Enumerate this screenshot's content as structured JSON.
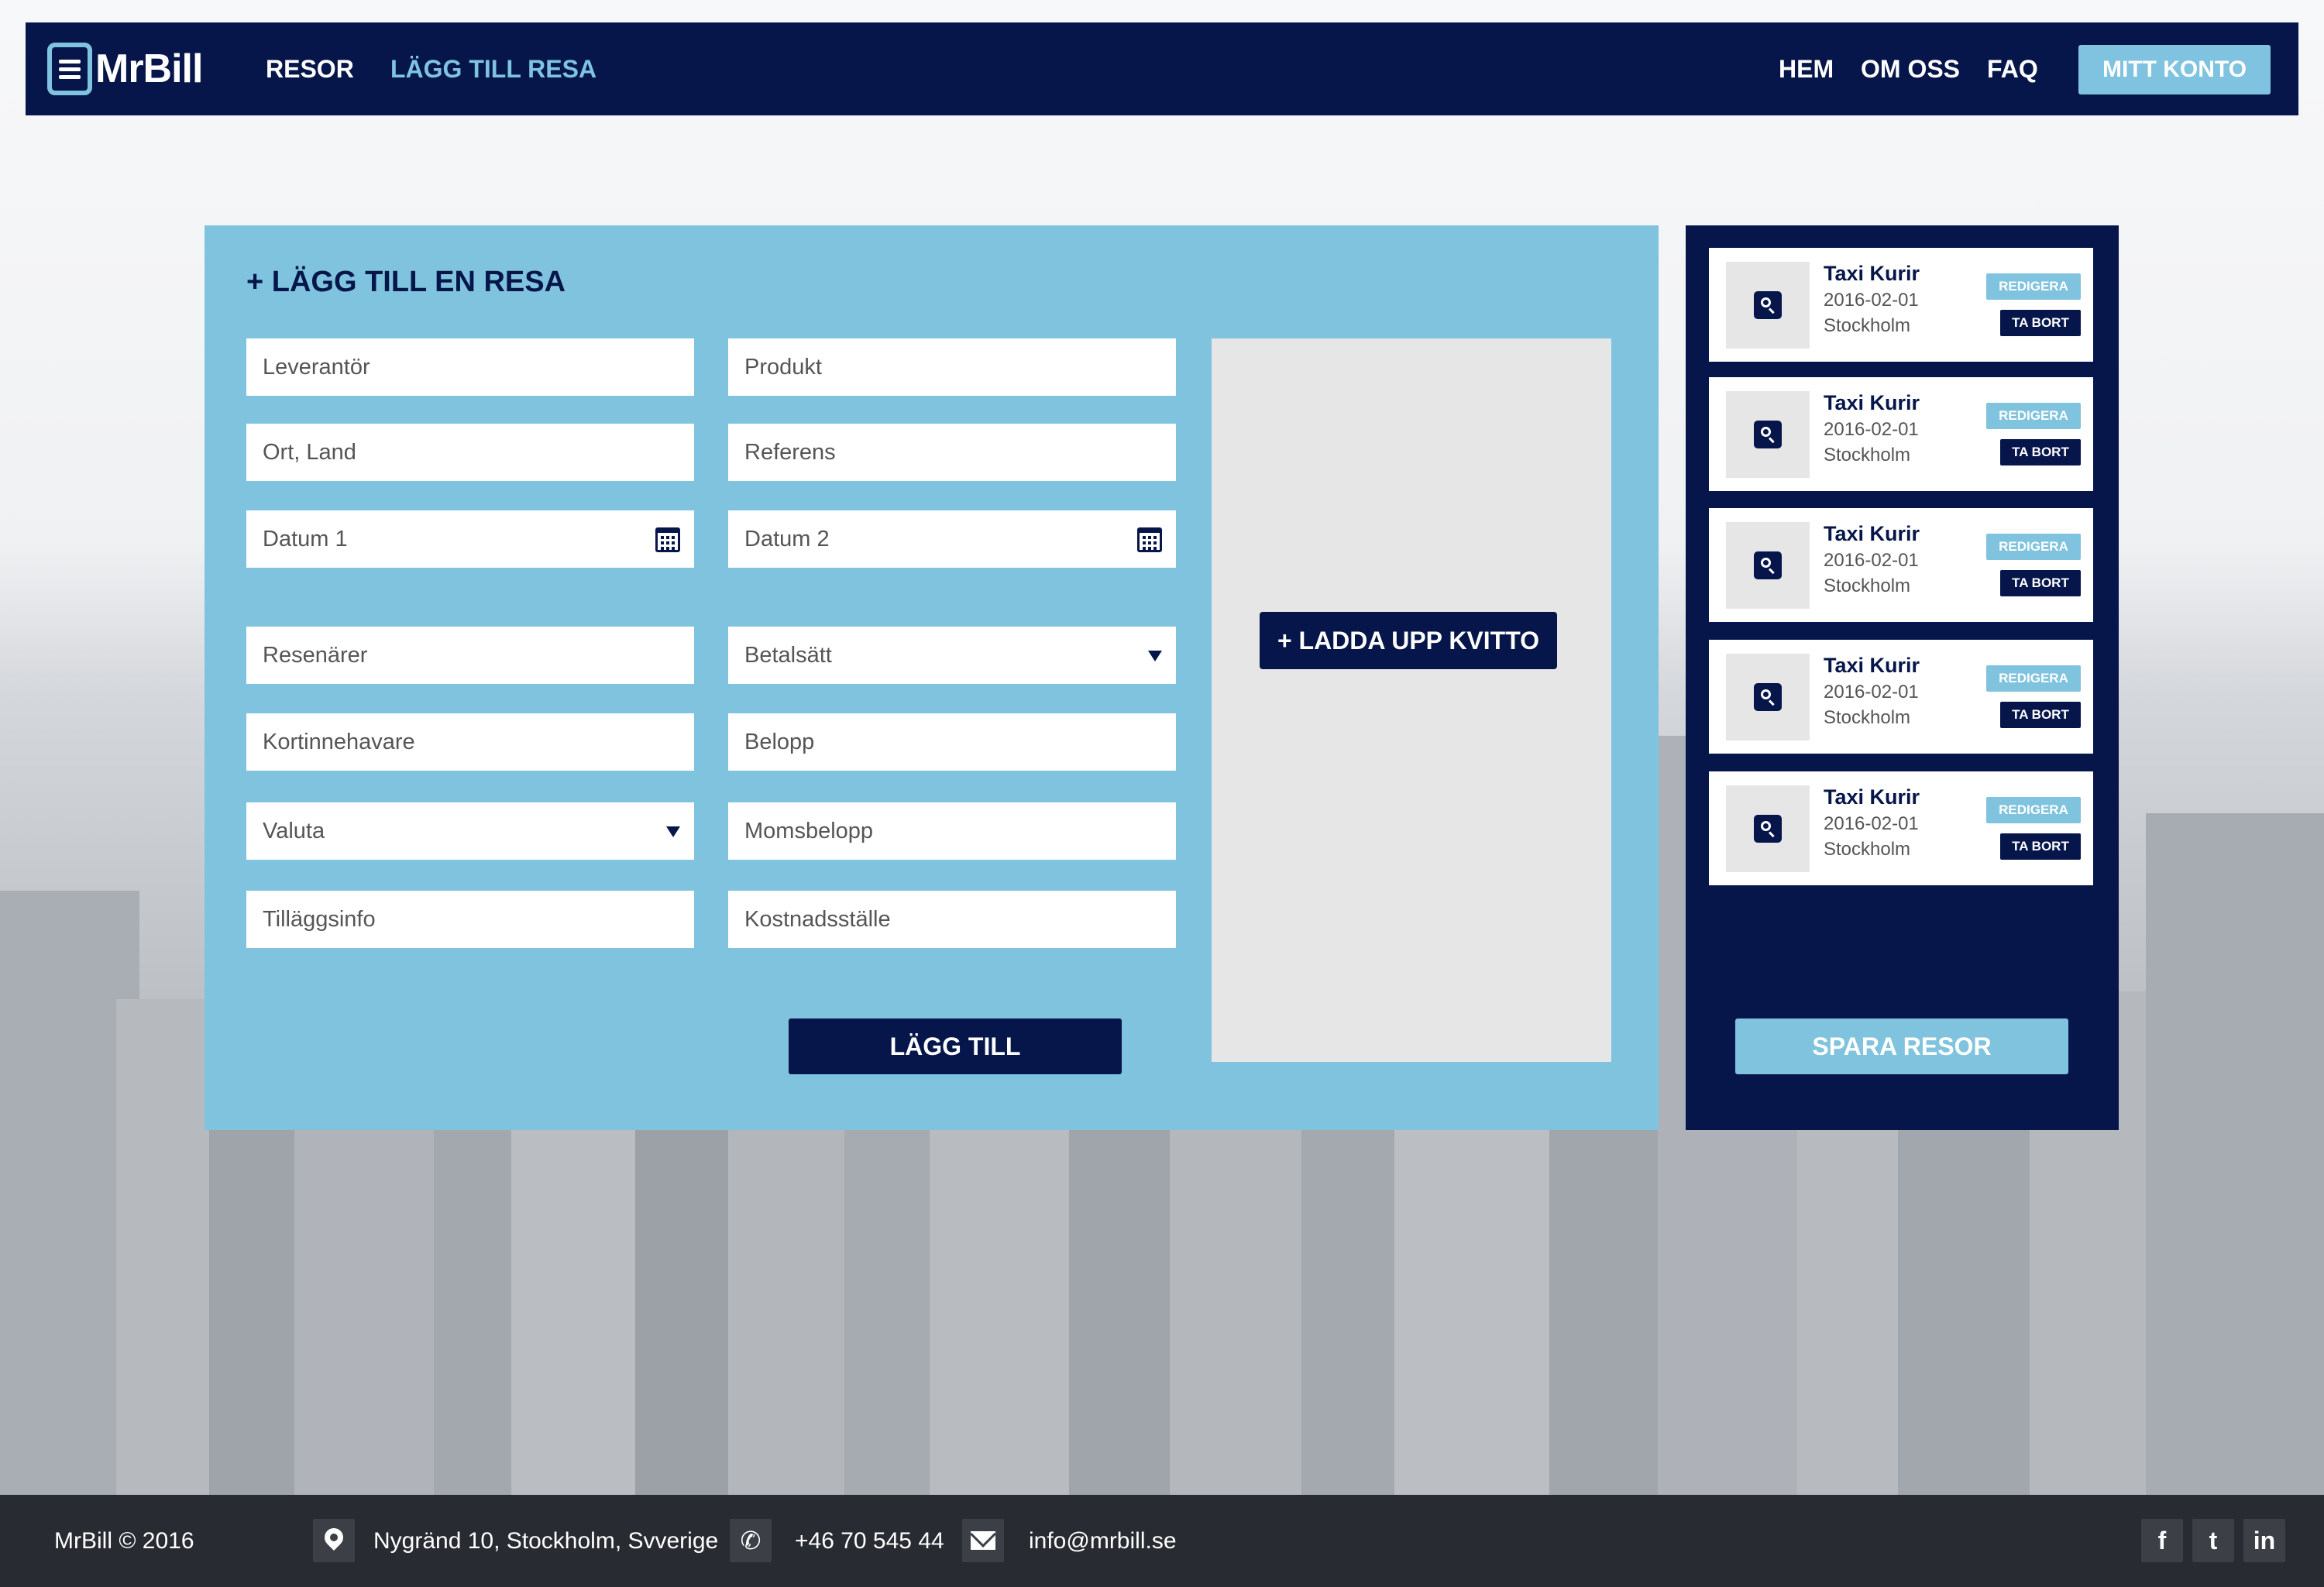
{
  "brand": {
    "logo_text": "MrBill"
  },
  "nav": {
    "left_links": [
      "RESOR",
      "LÄGG TILL RESA"
    ],
    "active_link": "LÄGG TILL RESA",
    "right_links": [
      "HEM",
      "OM OSS",
      "FAQ"
    ],
    "account_button": "MITT KONTO"
  },
  "form": {
    "title": "+ LÄGG TILL EN RESA",
    "fields": {
      "supplier": "Leverantör",
      "product": "Produkt",
      "location": "Ort, Land",
      "reference": "Referens",
      "date1": "Datum 1",
      "date2": "Datum 2",
      "travellers": "Resenärer",
      "payment_method": "Betalsätt",
      "cardholder": "Kortinnehavare",
      "amount": "Belopp",
      "currency": "Valuta",
      "vat_amount": "Momsbelopp",
      "extra_info": "Tilläggsinfo",
      "cost_center": "Kostnadsställe"
    },
    "upload_button": "+ LADDA UPP KVITTO",
    "submit_button": "LÄGG TILL"
  },
  "trips": {
    "items": [
      {
        "title": "Taxi Kurir",
        "date": "2016-02-01",
        "city": "Stockholm"
      },
      {
        "title": "Taxi Kurir",
        "date": "2016-02-01",
        "city": "Stockholm"
      },
      {
        "title": "Taxi Kurir",
        "date": "2016-02-01",
        "city": "Stockholm"
      },
      {
        "title": "Taxi Kurir",
        "date": "2016-02-01",
        "city": "Stockholm"
      },
      {
        "title": "Taxi Kurir",
        "date": "2016-02-01",
        "city": "Stockholm"
      }
    ],
    "edit_label": "REDIGERA",
    "delete_label": "TA BORT",
    "save_button": "SPARA RESOR"
  },
  "footer": {
    "copyright": "MrBill © 2016",
    "address": "Nygränd 10, Stockholm, Svverige",
    "phone": "+46 70 545 44",
    "email": "info@mrbill.se",
    "social": {
      "facebook": "f",
      "twitter": "t",
      "linkedin": "in"
    }
  },
  "colors": {
    "navy": "#06164a",
    "light_blue": "#80c3de",
    "footer_bg": "#282b31"
  },
  "icons": [
    "document-logo-icon",
    "calendar-icon",
    "dropdown-arrow-icon",
    "search-icon",
    "map-pin-icon",
    "phone-icon",
    "envelope-icon",
    "facebook-icon",
    "twitter-icon",
    "linkedin-icon"
  ]
}
